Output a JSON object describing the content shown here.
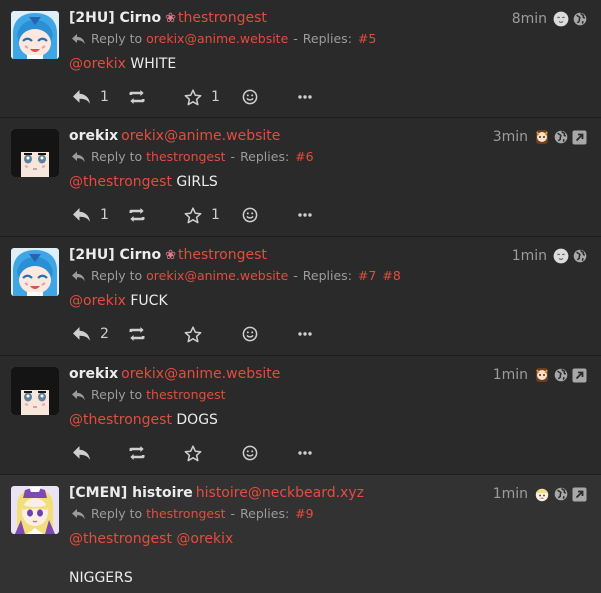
{
  "posts": [
    {
      "name": "[2HU] Cirno",
      "flower": "❀",
      "acct": "thestrongest",
      "reply_label": "Reply to",
      "reply_to": "orekix@anime.website",
      "replies_label": "Replies:",
      "replies": [
        "#5"
      ],
      "time": "8min",
      "mention": "@orekix",
      "text": "WHITE",
      "extra_text": "",
      "reply_count": "1",
      "fav_count": "1",
      "avatar": "cirno",
      "has_expand": false
    },
    {
      "name": "orekix",
      "flower": "",
      "acct": "orekix@anime.website",
      "reply_label": "Reply to",
      "reply_to": "thestrongest",
      "replies_label": "Replies:",
      "replies": [
        "#6"
      ],
      "time": "3min",
      "mention": "@thestrongest",
      "text": "GIRLS",
      "extra_text": "",
      "reply_count": "1",
      "fav_count": "1",
      "avatar": "orekix",
      "has_expand": true
    },
    {
      "name": "[2HU] Cirno",
      "flower": "❀",
      "acct": "thestrongest",
      "reply_label": "Reply to",
      "reply_to": "orekix@anime.website",
      "replies_label": "Replies:",
      "replies": [
        "#7",
        "#8"
      ],
      "time": "1min",
      "mention": "@orekix",
      "text": "FUCK",
      "extra_text": "",
      "reply_count": "2",
      "fav_count": "",
      "avatar": "cirno",
      "has_expand": false
    },
    {
      "name": "orekix",
      "flower": "",
      "acct": "orekix@anime.website",
      "reply_label": "Reply to",
      "reply_to": "thestrongest",
      "replies_label": "",
      "replies": [],
      "time": "1min",
      "mention": "@thestrongest",
      "text": "DOGS",
      "extra_text": "",
      "reply_count": "",
      "fav_count": "",
      "avatar": "orekix",
      "has_expand": true
    },
    {
      "name": "[CMEN] histoire",
      "flower": "",
      "acct": "histoire@neckbeard.xyz",
      "reply_label": "Reply to",
      "reply_to": "thestrongest",
      "replies_label": "Replies:",
      "replies": [
        "#9"
      ],
      "time": "1min",
      "mention": "@thestrongest @orekix",
      "text": "",
      "extra_text": "NIGGERS",
      "reply_count": "",
      "fav_count": "",
      "avatar": "histoire",
      "has_expand": true
    }
  ],
  "icons": {
    "reply": "reply-icon",
    "repeat": "repeat-icon",
    "favorite": "star-icon",
    "react": "smiley-icon",
    "more": "ellipsis-icon",
    "visibility": "globe-icon",
    "expand": "external-link-icon"
  },
  "colors": {
    "background": "#282828",
    "highlight_background": "#323232",
    "link": "#e24d3e",
    "text": "#ececec",
    "muted": "#9c9c9c"
  }
}
